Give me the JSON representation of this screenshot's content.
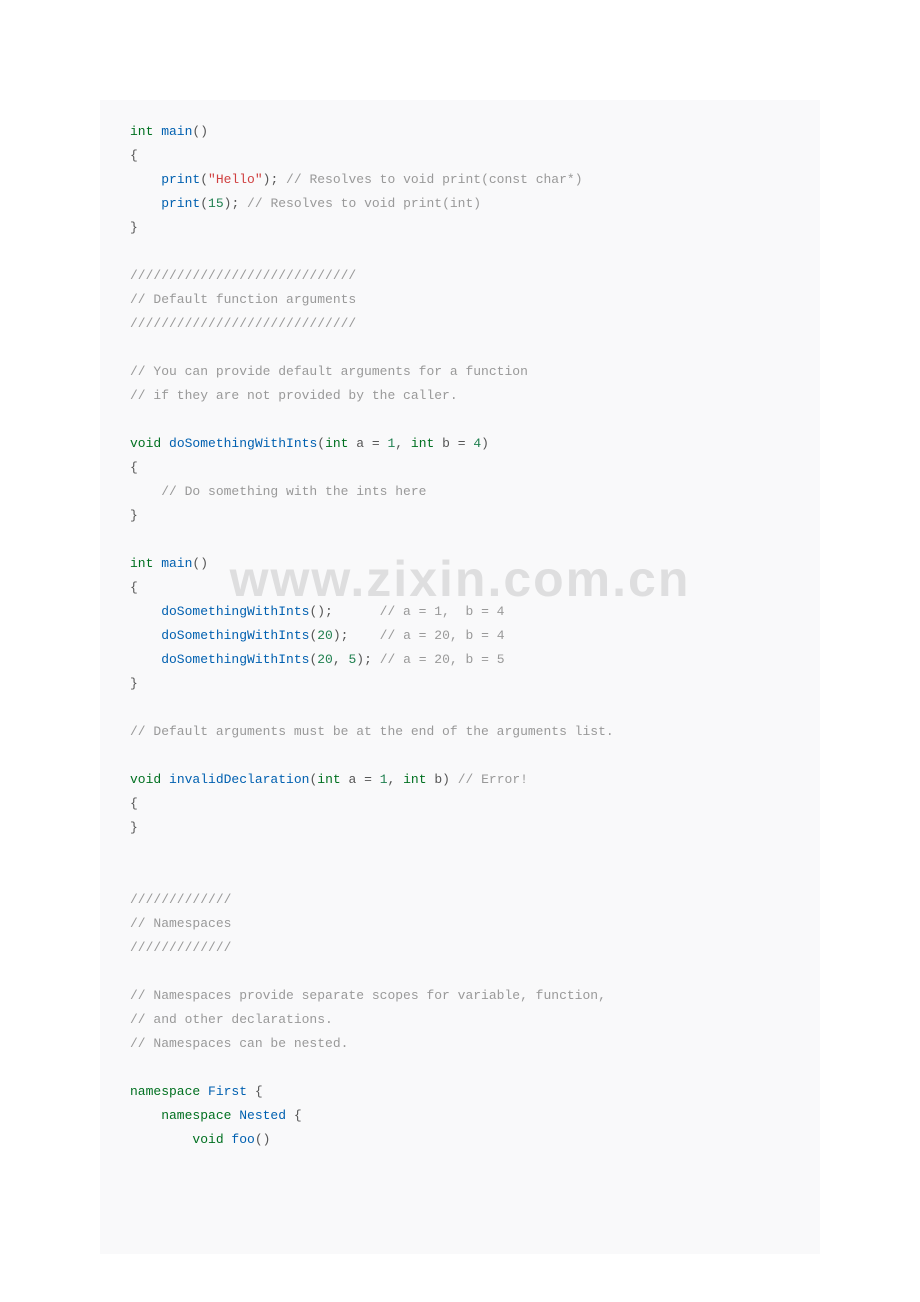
{
  "code": {
    "l1a": "int",
    "l1b": " main",
    "l1c": "()",
    "l2": "{",
    "l3a": "    print",
    "l3b": "(",
    "l3c": "\"Hello\"",
    "l3d": ");",
    "l3e": " // Resolves to void print(const char*)",
    "l4a": "    print",
    "l4b": "(",
    "l4c": "15",
    "l4d": ");",
    "l4e": " // Resolves to void print(int)",
    "l5": "}",
    "l7": "/////////////////////////////",
    "l8": "// Default function arguments",
    "l9": "/////////////////////////////",
    "l11": "// You can provide default arguments for a function",
    "l12": "// if they are not provided by the caller.",
    "l14a": "void",
    "l14b": " doSomethingWithInts",
    "l14c": "(",
    "l14d": "int",
    "l14e": " a = ",
    "l14f": "1",
    "l14g": ", ",
    "l14h": "int",
    "l14i": " b = ",
    "l14j": "4",
    "l14k": ")",
    "l15": "{",
    "l16": "    // Do something with the ints here",
    "l17": "}",
    "l19a": "int",
    "l19b": " main",
    "l19c": "()",
    "l20": "{",
    "l21a": "    doSomethingWithInts",
    "l21b": "();",
    "l21c": "      // a = 1,  b = 4",
    "l22a": "    doSomethingWithInts",
    "l22b": "(",
    "l22c": "20",
    "l22d": ");",
    "l22e": "    // a = 20, b = 4",
    "l23a": "    doSomethingWithInts",
    "l23b": "(",
    "l23c": "20",
    "l23d": ", ",
    "l23e": "5",
    "l23f": ");",
    "l23g": " // a = 20, b = 5",
    "l24": "}",
    "l26": "// Default arguments must be at the end of the arguments list.",
    "l28a": "void",
    "l28b": " invalidDeclaration",
    "l28c": "(",
    "l28d": "int",
    "l28e": " a = ",
    "l28f": "1",
    "l28g": ", ",
    "l28h": "int",
    "l28i": " b)",
    "l28j": " // Error!",
    "l29": "{",
    "l30": "}",
    "l33": "/////////////",
    "l34": "// Namespaces",
    "l35": "/////////////",
    "l37": "// Namespaces provide separate scopes for variable, function,",
    "l38": "// and other declarations.",
    "l39": "// Namespaces can be nested.",
    "l41a": "namespace",
    "l41b": " First",
    "l41c": " {",
    "l42a": "    namespace",
    "l42b": " Nested",
    "l42c": " {",
    "l43a": "        void",
    "l43b": " foo",
    "l43c": "()"
  },
  "watermark": "www.zixin.com.cn"
}
